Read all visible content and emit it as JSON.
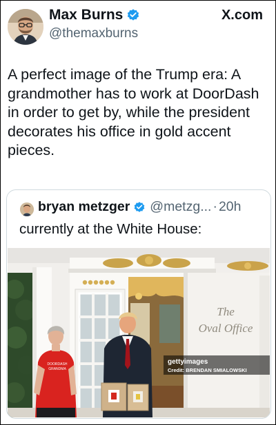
{
  "post": {
    "author_name": "Max Burns",
    "author_handle": "@themaxburns",
    "site": "X.com",
    "text": "A perfect image of the Trump era: A grandmother has to work at DoorDash in order to get by, while the president decorates his office in gold accent pieces."
  },
  "quoted_post": {
    "author_name": "bryan metzger",
    "author_handle": "@metzg...",
    "separator": "·",
    "time": "20h",
    "text": "currently at the White House:"
  },
  "photo": {
    "sign_line1": "The",
    "sign_line2": "Oval Office",
    "watermark_brand": "gettyimages",
    "watermark_credit": "Credit: BRENDAN SMIALOWSKI",
    "shirt_text_line1": "DOORDASH",
    "shirt_text_line2": "GRANDMA"
  },
  "colors": {
    "verified_blue": "#1d9bf0",
    "text_primary": "#0f1419",
    "text_secondary": "#536471"
  },
  "icons": {
    "verified": "verified-badge-icon",
    "x_logo": "x-logo-icon"
  }
}
